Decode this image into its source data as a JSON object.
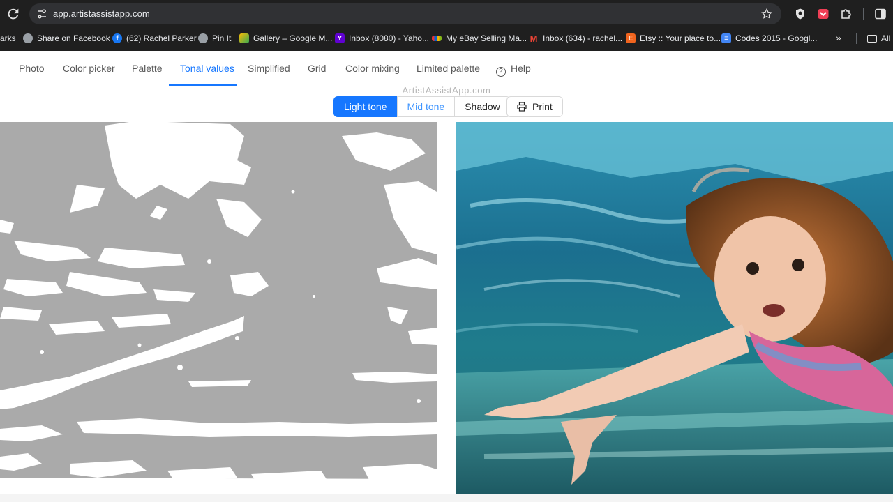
{
  "browser": {
    "url": "app.artistassistapp.com",
    "bookmarks": [
      {
        "label": "arks",
        "icon": "bookmarks-overflow",
        "color": "#1f1f1f"
      },
      {
        "label": "Share on Facebook",
        "icon": "globe-icon",
        "color": "#9aa0a6"
      },
      {
        "label": "(62) Rachel Parker",
        "icon": "facebook-icon",
        "color": "#1877f2"
      },
      {
        "label": "Pin It",
        "icon": "globe-icon",
        "color": "#9aa0a6"
      },
      {
        "label": "Gallery – Google M...",
        "icon": "google-photos-icon",
        "color": "#34a853"
      },
      {
        "label": "Inbox (8080) - Yaho...",
        "icon": "yahoo-icon",
        "color": "#6001d2"
      },
      {
        "label": "My eBay Selling Ma...",
        "icon": "ebay-icon",
        "color": "#e53238"
      },
      {
        "label": "Inbox (634) - rachel...",
        "icon": "gmail-icon",
        "color": "#ea4335"
      },
      {
        "label": "Etsy :: Your place to...",
        "icon": "etsy-icon",
        "color": "#f1641e"
      },
      {
        "label": "Codes 2015 - Googl...",
        "icon": "google-docs-icon",
        "color": "#4285f4"
      },
      {
        "label": "All",
        "icon": "folder-icon",
        "color": "#e3e3e3"
      }
    ]
  },
  "nav": {
    "tabs": [
      {
        "label": "Photo",
        "active": false
      },
      {
        "label": "Color picker",
        "active": false
      },
      {
        "label": "Palette",
        "active": false
      },
      {
        "label": "Tonal values",
        "active": true
      },
      {
        "label": "Simplified",
        "active": false
      },
      {
        "label": "Grid",
        "active": false
      },
      {
        "label": "Color mixing",
        "active": false
      },
      {
        "label": "Limited palette",
        "active": false
      },
      {
        "label": "Help",
        "active": false,
        "icon": "question-circle-icon"
      }
    ],
    "accent_color": "#1677ff"
  },
  "watermark": "ArtistAssistApp.com",
  "tone_selector": {
    "options": [
      "Light tone",
      "Mid tone",
      "Shadow"
    ],
    "selected": "Light tone"
  },
  "print_label": "Print"
}
